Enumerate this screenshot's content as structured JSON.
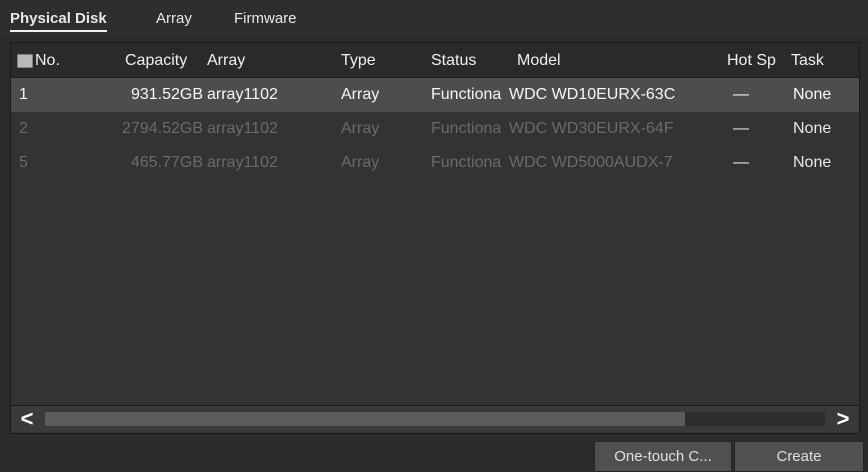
{
  "tabs": [
    "Physical Disk",
    "Array",
    "Firmware"
  ],
  "columns": {
    "no": "No.",
    "capacity": "Capacity",
    "array": "Array",
    "type": "Type",
    "status": "Status",
    "model": "Model",
    "hot_spare": "Hot Sp",
    "task": "Task"
  },
  "rows": [
    {
      "no": "1",
      "capacity": "931.52GB",
      "array": "array1102",
      "type": "Array",
      "status": "Functiona",
      "model": "WDC WD10EURX-63C",
      "hot_spare": "—",
      "task": "None"
    },
    {
      "no": "2",
      "capacity": "2794.52GB",
      "array": "array1102",
      "type": "Array",
      "status": "Functiona",
      "model": "WDC WD30EURX-64F",
      "hot_spare": "—",
      "task": "None"
    },
    {
      "no": "5",
      "capacity": "465.77GB",
      "array": "array1102",
      "type": "Array",
      "status": "Functiona",
      "model": "WDC WD5000AUDX-7",
      "hot_spare": "—",
      "task": "None"
    }
  ],
  "scroll": {
    "left_icon": "<",
    "right_icon": ">",
    "thumb_fraction": 0.82
  },
  "buttons": {
    "one_touch": "One-touch C...",
    "create": "Create"
  }
}
